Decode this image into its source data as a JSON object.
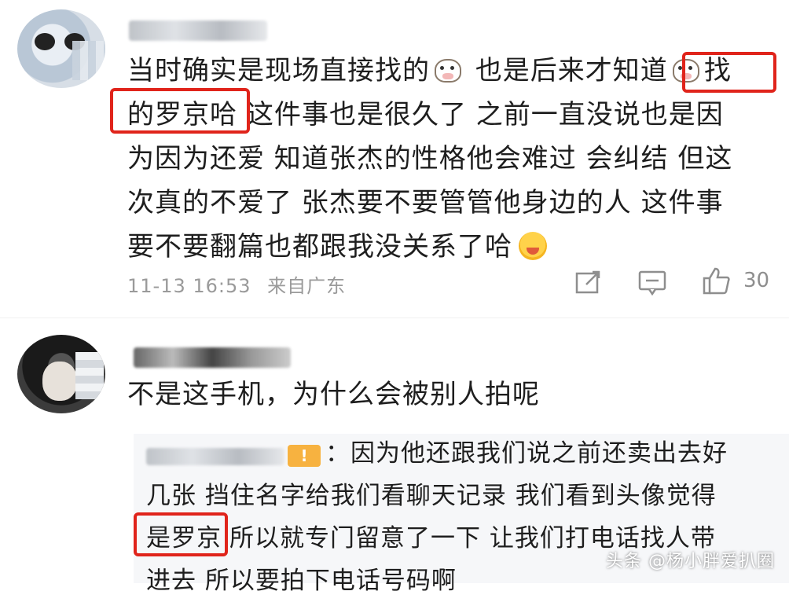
{
  "comment1": {
    "lines": [
      [
        "当时确实是现场直接找的",
        "也是后来才知道",
        "找"
      ],
      [
        "的罗京哈",
        "这件事也是很久了 之前一直没说也是因"
      ],
      "为因为还爱 知道张杰的性格他会难过 会纠结 但这",
      "次真的不爱了 张杰要不要管管他身边的人 这件事",
      "要不要翻篇也都跟我没关系了哈"
    ],
    "timestamp": "11-13 16:53",
    "location": "来自广东",
    "likes": "30"
  },
  "comment2": {
    "text": "不是这手机，为什么会被别人拍呢",
    "reply": {
      "tag": "!",
      "lines": [
        "：因为他还跟我们说之前还卖出去好",
        "几张 挡住名字给我们看聊天记录 我们看到头像觉得",
        [
          "是罗京",
          "所以就专门留意了一下 让我们打电话找人带"
        ],
        "进去 所以要拍下电话号码啊"
      ]
    }
  },
  "watermark": "头条 @杨小胖爱扒圈",
  "colors": {
    "highlight_box": "#e0241b",
    "meta_gray": "#9a9a9a"
  },
  "icons": [
    "cow-emoji",
    "laughing-face-emoji",
    "share-icon",
    "comment-icon",
    "thumbs-up-icon"
  ]
}
